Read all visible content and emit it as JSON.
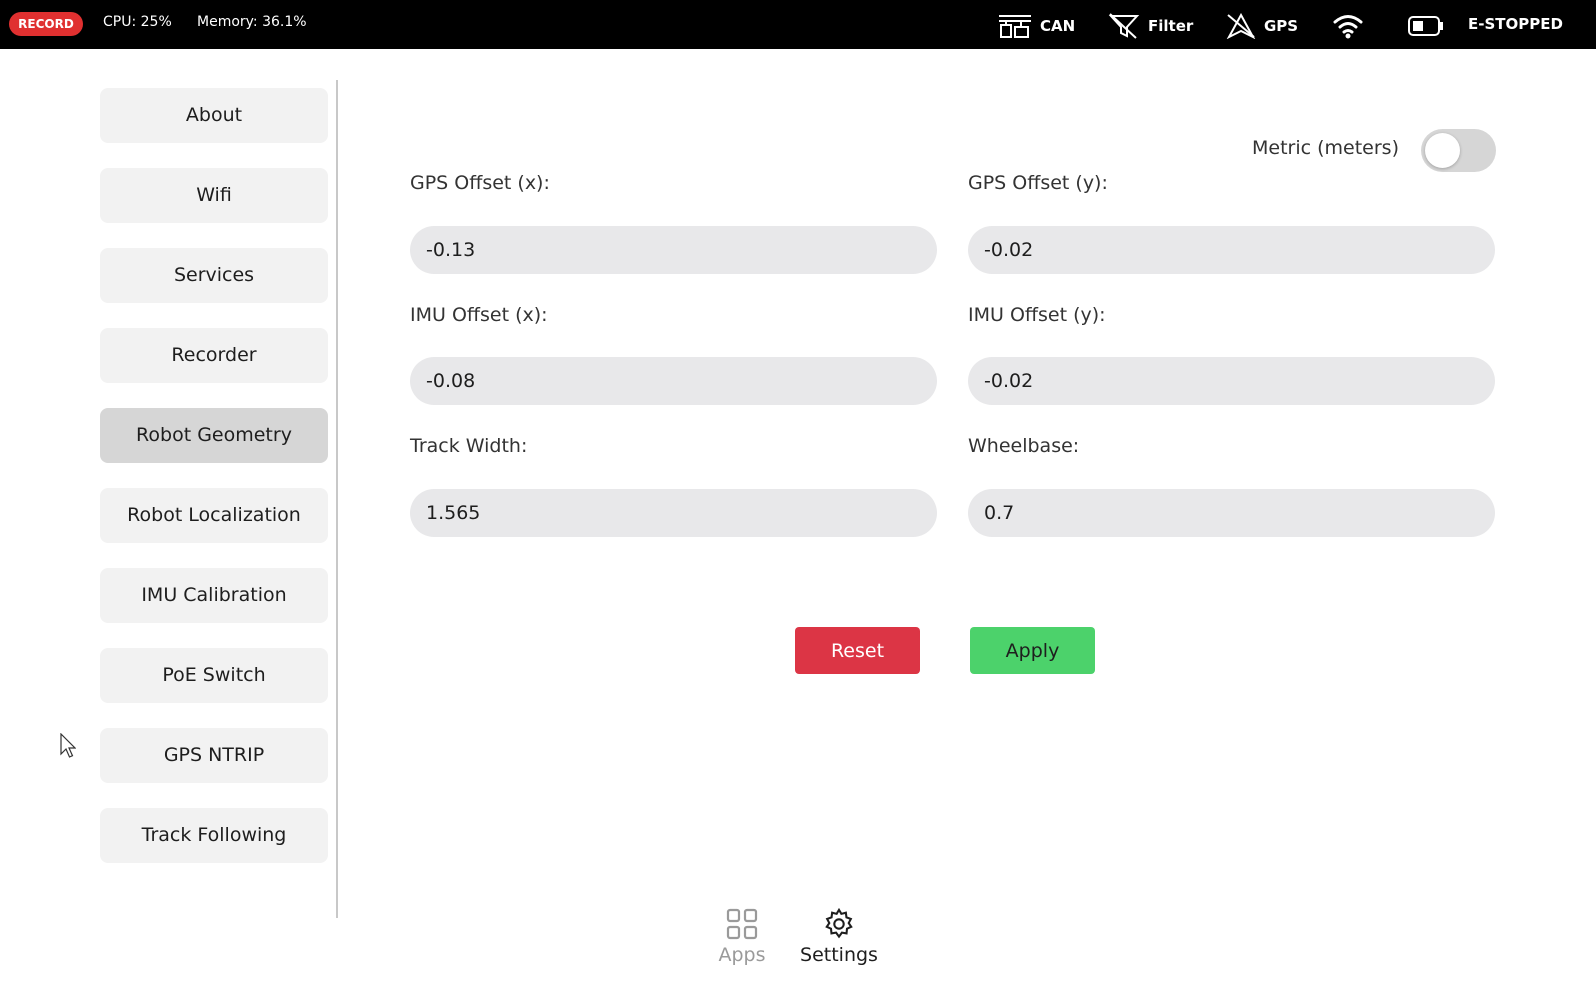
{
  "topbar": {
    "record_label": "RECORD",
    "cpu": "CPU: 25%",
    "memory": "Memory: 36.1%",
    "status": {
      "can": "CAN",
      "filter": "Filter",
      "gps": "GPS",
      "estop": "E-STOPPED"
    }
  },
  "sidebar": {
    "items": [
      {
        "label": "About"
      },
      {
        "label": "Wifi"
      },
      {
        "label": "Services"
      },
      {
        "label": "Recorder"
      },
      {
        "label": "Robot Geometry"
      },
      {
        "label": "Robot Localization"
      },
      {
        "label": "IMU Calibration"
      },
      {
        "label": "PoE Switch"
      },
      {
        "label": "GPS NTRIP"
      },
      {
        "label": "Track Following"
      }
    ],
    "active": "Robot Geometry"
  },
  "form": {
    "metric_label": "Metric (meters)",
    "metric_enabled": false,
    "fields": [
      {
        "label": "GPS Offset (x):",
        "value": "-0.13"
      },
      {
        "label": "GPS Offset (y):",
        "value": "-0.02"
      },
      {
        "label": "IMU Offset (x):",
        "value": "-0.08"
      },
      {
        "label": "IMU Offset (y):",
        "value": "-0.02"
      },
      {
        "label": "Track Width:",
        "value": "1.565"
      },
      {
        "label": "Wheelbase:",
        "value": "0.7"
      }
    ],
    "reset_label": "Reset",
    "apply_label": "Apply"
  },
  "bottom_nav": {
    "apps_label": "Apps",
    "settings_label": "Settings",
    "active": "Settings"
  },
  "colors": {
    "reset": "#dc3545",
    "apply": "#4cd26b",
    "record": "#e03030",
    "active_sidebar": "#d6d6d6"
  }
}
